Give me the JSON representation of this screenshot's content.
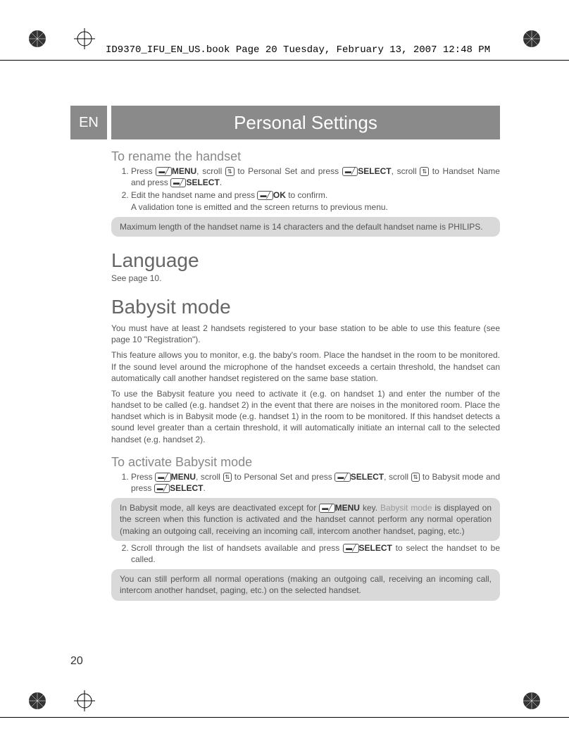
{
  "header_line": "ID9370_IFU_EN_US.book  Page 20  Tuesday, February 13, 2007  12:48 PM",
  "lang_tab": "EN",
  "page_title": "Personal Settings",
  "rename": {
    "heading": "To rename the handset",
    "step1_a": "Press ",
    "step1_menu": "MENU",
    "step1_b": ", scroll ",
    "step1_c": " to Personal Set and press ",
    "step1_select": "SELECT",
    "step1_d": ", scroll ",
    "step1_e": " to Handset Name and press ",
    "step1_select2": "SELECT",
    "step1_f": ".",
    "step2_a": "Edit the handset name and press ",
    "step2_ok": "OK",
    "step2_b": " to confirm.",
    "step2_c": "A validation tone is emitted and the screen returns to previous menu.",
    "note": "Maximum length of the handset name is 14 characters and the default handset name is PHILIPS."
  },
  "language": {
    "heading": "Language",
    "sub": "See page 10."
  },
  "babysit": {
    "heading": "Babysit mode",
    "p1": "You must have at least 2 handsets registered to your base station to be able to use this feature (see page 10 \"Registration\").",
    "p2": "This feature allows you to monitor, e.g. the baby's room. Place the handset in the room to be monitored. If the sound level around the microphone of the handset exceeds a certain threshold, the handset can automatically call another handset registered on the same base station.",
    "p3": "To use the Babysit feature you need to activate it (e.g. on handset 1) and enter the number of the handset to be called (e.g. handset 2) in the event that there are noises in the monitored room. Place the handset which is in Babysit mode (e.g. handset 1) in the room to be monitored. If this handset detects a sound level greater than a certain threshold, it will automatically initiate an internal call to the selected handset (e.g. handset 2).",
    "activate_heading": "To activate Babysit mode",
    "act_step1_a": "Press ",
    "act_step1_menu": "MENU",
    "act_step1_b": ", scroll ",
    "act_step1_c": " to Personal Set and press ",
    "act_step1_select": "SELECT",
    "act_step1_d": ", scroll ",
    "act_step1_e": " to Babysit mode and press ",
    "act_step1_select2": "SELECT",
    "act_step1_f": ".",
    "note1_a": "In Babysit mode, all keys are deactivated except for ",
    "note1_menu": "MENU",
    "note1_b": " key. ",
    "note1_babysit": "Babysit mode",
    "note1_c": " is displayed on the screen when this function is activated and the handset cannot perform any normal operation (making an outgoing call, receiving an incoming call, intercom another handset, paging, etc.)",
    "act_step2_a": "Scroll through the list of handsets available and press ",
    "act_step2_select": "SELECT",
    "act_step2_b": " to select the handset to be called.",
    "note2": "You can still perform all normal operations (making an outgoing call, receiving an incoming call, intercom another handset, paging, etc.) on the selected handset."
  },
  "page_number": "20"
}
